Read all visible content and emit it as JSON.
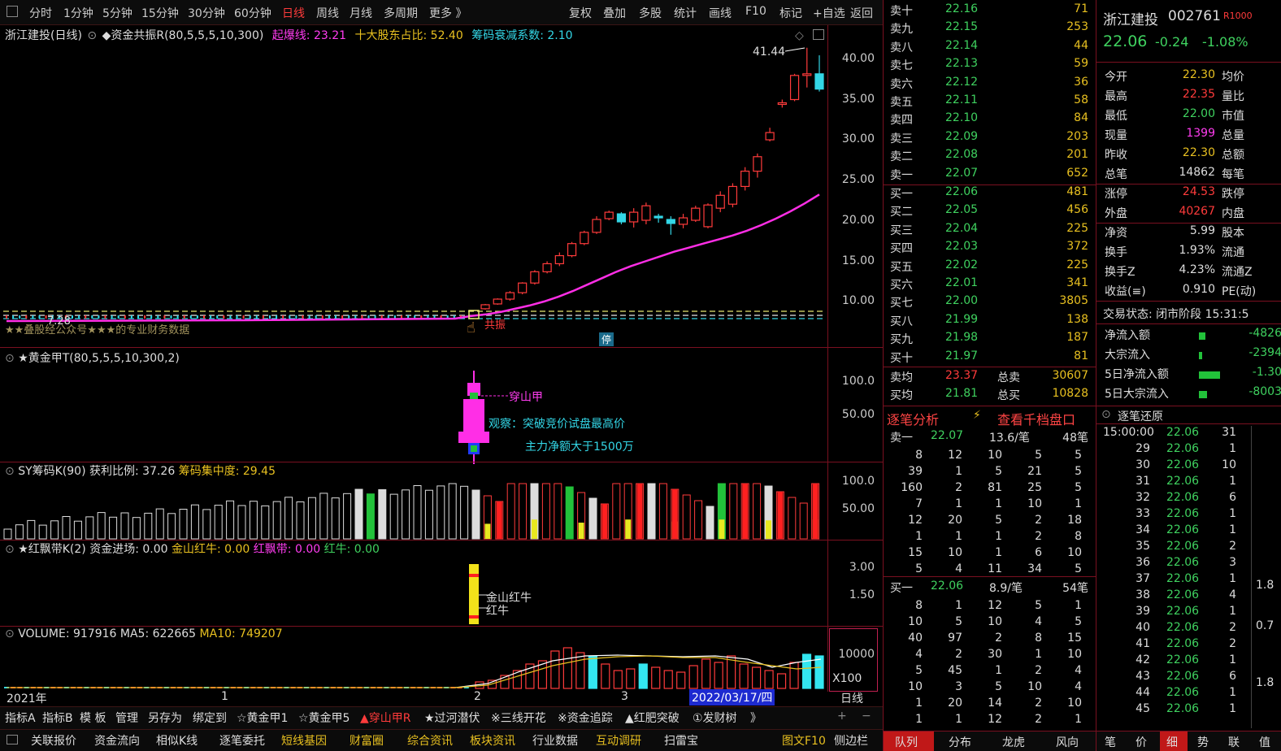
{
  "toolbar": {
    "left": [
      "分时",
      "1分钟",
      "5分钟",
      "15分钟",
      "30分钟",
      "60分钟",
      "日线",
      "周线",
      "月线",
      "多周期",
      "更多 》"
    ],
    "right": [
      "复权",
      "叠加",
      "多股",
      "统计",
      "画线",
      "F10",
      "标记",
      "+自选",
      "返回"
    ],
    "active": "日线"
  },
  "main": {
    "stock_label": "浙江建投(日线)",
    "indicator": "◆资金共振R(80,5,5,5,10,300)",
    "qibao_label": "起爆线:",
    "qibao": "23.21",
    "gudong_label": "十大股东占比:",
    "gudong": "52.40",
    "chouma_label": "筹码衰减系数:",
    "chouma": "2.10",
    "peak": "41.44",
    "low": "7.28",
    "watermark": "★★叠股经公众号★★★的专业财务数据",
    "gongzhen": "共振",
    "ting": "停",
    "yticks": [
      "40.00",
      "35.00",
      "30.00",
      "25.00",
      "20.00",
      "15.00",
      "10.00"
    ]
  },
  "p2": {
    "title": "★黄金甲T(80,5,5,5,10,300,2)",
    "yticks": [
      "100.0",
      "50.00"
    ],
    "ann1": "穿山甲",
    "ann2": "观察：突破竞价试盘最高价",
    "ann3": "主力净额大于1500万"
  },
  "p3": {
    "title": "SY筹码K(90)",
    "huoli_label": "获利比例:",
    "huoli": "37.26",
    "jizhong_label": "筹码集中度:",
    "jizhong": "29.45",
    "yticks": [
      "100.0",
      "50.00"
    ]
  },
  "p4": {
    "title": "★红飘带K(2)",
    "zj_label": "资金进场:",
    "zj": "0.00",
    "jshn_label": "金山红牛:",
    "jshn": "0.00",
    "hpd_label": "红飘带:",
    "hpd": "0.00",
    "hn_label": "红牛:",
    "hn": "0.00",
    "yticks": [
      "3.00",
      "1.50"
    ],
    "ann1": "金山红牛",
    "ann2": "红牛"
  },
  "p5": {
    "title": "VOLUME:",
    "vol": "917916",
    "ma5_label": "MA5:",
    "ma5": "622665",
    "ma10_label": "MA10:",
    "ma10": "749207",
    "ytick": "10000",
    "unit": "X100"
  },
  "xaxis": {
    "year": "2021年",
    "m1": "1",
    "m2": "2",
    "m3": "3",
    "cursor": "2022/03/17/四",
    "period": "日线"
  },
  "tabs1": [
    "指标A",
    "指标B",
    "模 板",
    "管理",
    "另存为",
    "绑定到",
    "☆黄金甲1",
    "☆黄金甲5",
    "▲穿山甲R",
    "★过河潜伏",
    "※三线开花",
    "※资金追踪",
    "▲红肥突破",
    "①发财树",
    "》"
  ],
  "tabs2": [
    "关联报价",
    "资金流向",
    "相似K线",
    "逐笔委托",
    "短线基因",
    "财富圈",
    "综合资讯",
    "板块资讯",
    "行业数据",
    "互动调研",
    "扫雷宝"
  ],
  "tabs2_right": [
    "图文F10",
    "侧边栏"
  ],
  "orderbook": {
    "sell": [
      [
        "卖十",
        "22.16",
        "71"
      ],
      [
        "卖九",
        "22.15",
        "253"
      ],
      [
        "卖八",
        "22.14",
        "44"
      ],
      [
        "卖七",
        "22.13",
        "59"
      ],
      [
        "卖六",
        "22.12",
        "36"
      ],
      [
        "卖五",
        "22.11",
        "58"
      ],
      [
        "卖四",
        "22.10",
        "84"
      ],
      [
        "卖三",
        "22.09",
        "203"
      ],
      [
        "卖二",
        "22.08",
        "201"
      ],
      [
        "卖一",
        "22.07",
        "652"
      ]
    ],
    "buy": [
      [
        "买一",
        "22.06",
        "481"
      ],
      [
        "买二",
        "22.05",
        "456"
      ],
      [
        "买三",
        "22.04",
        "225"
      ],
      [
        "买四",
        "22.03",
        "372"
      ],
      [
        "买五",
        "22.02",
        "225"
      ],
      [
        "买六",
        "22.01",
        "341"
      ],
      [
        "买七",
        "22.00",
        "3805"
      ],
      [
        "买八",
        "21.99",
        "138"
      ],
      [
        "买九",
        "21.98",
        "187"
      ],
      [
        "买十",
        "21.97",
        "81"
      ]
    ],
    "avg_sell_label": "卖均",
    "avg_sell": "23.37",
    "tot_sell_label": "总卖",
    "tot_sell": "30607",
    "avg_buy_label": "买均",
    "avg_buy": "21.81",
    "tot_buy_label": "总买",
    "tot_buy": "10828"
  },
  "analysis": {
    "title": "逐笔分析",
    "link": "查看千档盘口",
    "s1": {
      "label": "卖一",
      "price": "22.07",
      "per": "13.6/笔",
      "count": "48笔",
      "rows": [
        [
          "8",
          "12",
          "10",
          "5",
          "5"
        ],
        [
          "39",
          "1",
          "5",
          "21",
          "5"
        ],
        [
          "160",
          "2",
          "81",
          "25",
          "5"
        ],
        [
          "7",
          "1",
          "1",
          "10",
          "1"
        ],
        [
          "12",
          "20",
          "5",
          "2",
          "18"
        ],
        [
          "1",
          "1",
          "1",
          "2",
          "8"
        ],
        [
          "15",
          "10",
          "1",
          "6",
          "10"
        ],
        [
          "5",
          "4",
          "11",
          "34",
          "5"
        ]
      ]
    },
    "b1": {
      "label": "买一",
      "price": "22.06",
      "per": "8.9/笔",
      "count": "54笔",
      "rows": [
        [
          "8",
          "1",
          "12",
          "5",
          "1"
        ],
        [
          "10",
          "5",
          "10",
          "4",
          "5"
        ],
        [
          "40",
          "97",
          "2",
          "8",
          "15"
        ],
        [
          "4",
          "2",
          "30",
          "1",
          "10"
        ],
        [
          "5",
          "45",
          "1",
          "2",
          "4"
        ],
        [
          "10",
          "3",
          "5",
          "10",
          "4"
        ],
        [
          "1",
          "20",
          "14",
          "2",
          "10"
        ],
        [
          "1",
          "1",
          "12",
          "2",
          "1"
        ]
      ]
    }
  },
  "right_tabs": [
    "队列",
    "分布",
    "龙虎",
    "风向"
  ],
  "quote": {
    "name": "浙江建投",
    "code": "002761",
    "badge": "R1000",
    "price": "22.06",
    "change": "-0.24",
    "pct": "-1.08%",
    "rows": [
      [
        "今开",
        "22.30",
        "均价"
      ],
      [
        "最高",
        "22.35",
        "量比"
      ],
      [
        "最低",
        "22.00",
        "市值"
      ],
      [
        "现量",
        "1399",
        "总量"
      ],
      [
        "昨收",
        "22.30",
        "总额"
      ],
      [
        "总笔",
        "14862",
        "每笔"
      ],
      [
        "涨停",
        "24.53",
        "跌停"
      ],
      [
        "外盘",
        "40267",
        "内盘"
      ],
      [
        "净资",
        "5.99",
        "股本"
      ],
      [
        "换手",
        "1.93%",
        "流通"
      ],
      [
        "换手Z",
        "4.23%",
        "流通Z"
      ],
      [
        "收益(≡)",
        "0.910",
        "PE(动)"
      ]
    ],
    "status": "交易状态: 闭市阶段 15:31:5",
    "flows": [
      [
        "净流入额",
        "-4826"
      ],
      [
        "大宗流入",
        "-2394"
      ],
      [
        "5日净流入额",
        "-1.30"
      ],
      [
        "5日大宗流入",
        "-8003"
      ]
    ],
    "zb_title": "逐笔还原",
    "trades": [
      [
        "15:00:00",
        "22.06",
        "31"
      ],
      [
        "29",
        "22.06",
        "1"
      ],
      [
        "30",
        "22.06",
        "10"
      ],
      [
        "31",
        "22.06",
        "1"
      ],
      [
        "32",
        "22.06",
        "6"
      ],
      [
        "33",
        "22.06",
        "1"
      ],
      [
        "34",
        "22.06",
        "1"
      ],
      [
        "35",
        "22.06",
        "2"
      ],
      [
        "36",
        "22.06",
        "3"
      ],
      [
        "37",
        "22.06",
        "1"
      ],
      [
        "38",
        "22.06",
        "4"
      ],
      [
        "39",
        "22.06",
        "1"
      ],
      [
        "40",
        "22.06",
        "2"
      ],
      [
        "41",
        "22.06",
        "2"
      ],
      [
        "42",
        "22.06",
        "1"
      ],
      [
        "43",
        "22.06",
        "6"
      ],
      [
        "44",
        "22.06",
        "1"
      ],
      [
        "45",
        "22.06",
        "1"
      ]
    ],
    "side_vals": [
      "1.8",
      "0.7",
      "1.8"
    ],
    "bottom_tabs": [
      "笔",
      "价",
      "细",
      "势",
      "联",
      "值"
    ],
    "bottom_active": "细"
  },
  "chart_data": {
    "type": "candlestick",
    "title": "浙江建投(日线)",
    "ylim": [
      5,
      42
    ],
    "peak": 41.44,
    "ohlc": [
      [
        9.0,
        9.6,
        8.9,
        9.5
      ],
      [
        9.6,
        10.3,
        9.5,
        10.2
      ],
      [
        10.2,
        11.2,
        10.0,
        11.0
      ],
      [
        11.0,
        12.3,
        10.8,
        12.2
      ],
      [
        12.2,
        13.8,
        12.0,
        13.6
      ],
      [
        13.6,
        14.9,
        13.4,
        14.6
      ],
      [
        14.6,
        16.0,
        14.3,
        15.6
      ],
      [
        15.6,
        17.3,
        15.4,
        17.1
      ],
      [
        17.1,
        18.7,
        16.9,
        18.5
      ],
      [
        18.5,
        20.5,
        18.3,
        20.1
      ],
      [
        20.2,
        21.2,
        20.0,
        21.0
      ],
      [
        20.8,
        21.0,
        19.5,
        19.8
      ],
      [
        19.8,
        21.5,
        19.1,
        21.0
      ],
      [
        20.0,
        22.2,
        19.5,
        21.8
      ],
      [
        20.5,
        20.8,
        19.7,
        20.4
      ],
      [
        20.1,
        20.5,
        18.2,
        19.6
      ],
      [
        19.5,
        20.8,
        19.0,
        20.3
      ],
      [
        20.0,
        21.8,
        19.8,
        21.5
      ],
      [
        19.2,
        22.1,
        19.0,
        21.9
      ],
      [
        21.5,
        23.6,
        21.0,
        23.1
      ],
      [
        22.0,
        24.6,
        21.6,
        24.2
      ],
      [
        24.2,
        26.6,
        23.7,
        26.1
      ],
      [
        26.1,
        28.3,
        25.3,
        27.9
      ],
      [
        30.0,
        31.5,
        29.8,
        30.9
      ],
      [
        34.5,
        35.0,
        34.0,
        34.6
      ],
      [
        35.0,
        38.2,
        34.8,
        38.0
      ],
      [
        38.0,
        41.44,
        36.5,
        38.2
      ],
      [
        38.2,
        40.5,
        36.0,
        36.3
      ]
    ],
    "ma": [
      8.1,
      8.3,
      8.6,
      9.0,
      9.4,
      9.9,
      10.5,
      11.2,
      12.0,
      12.8,
      13.6,
      14.3,
      14.9,
      15.5,
      16.1,
      16.6,
      17.1,
      17.6,
      18.1,
      18.7,
      19.4,
      20.2,
      21.1,
      22.1,
      23.2
    ]
  }
}
